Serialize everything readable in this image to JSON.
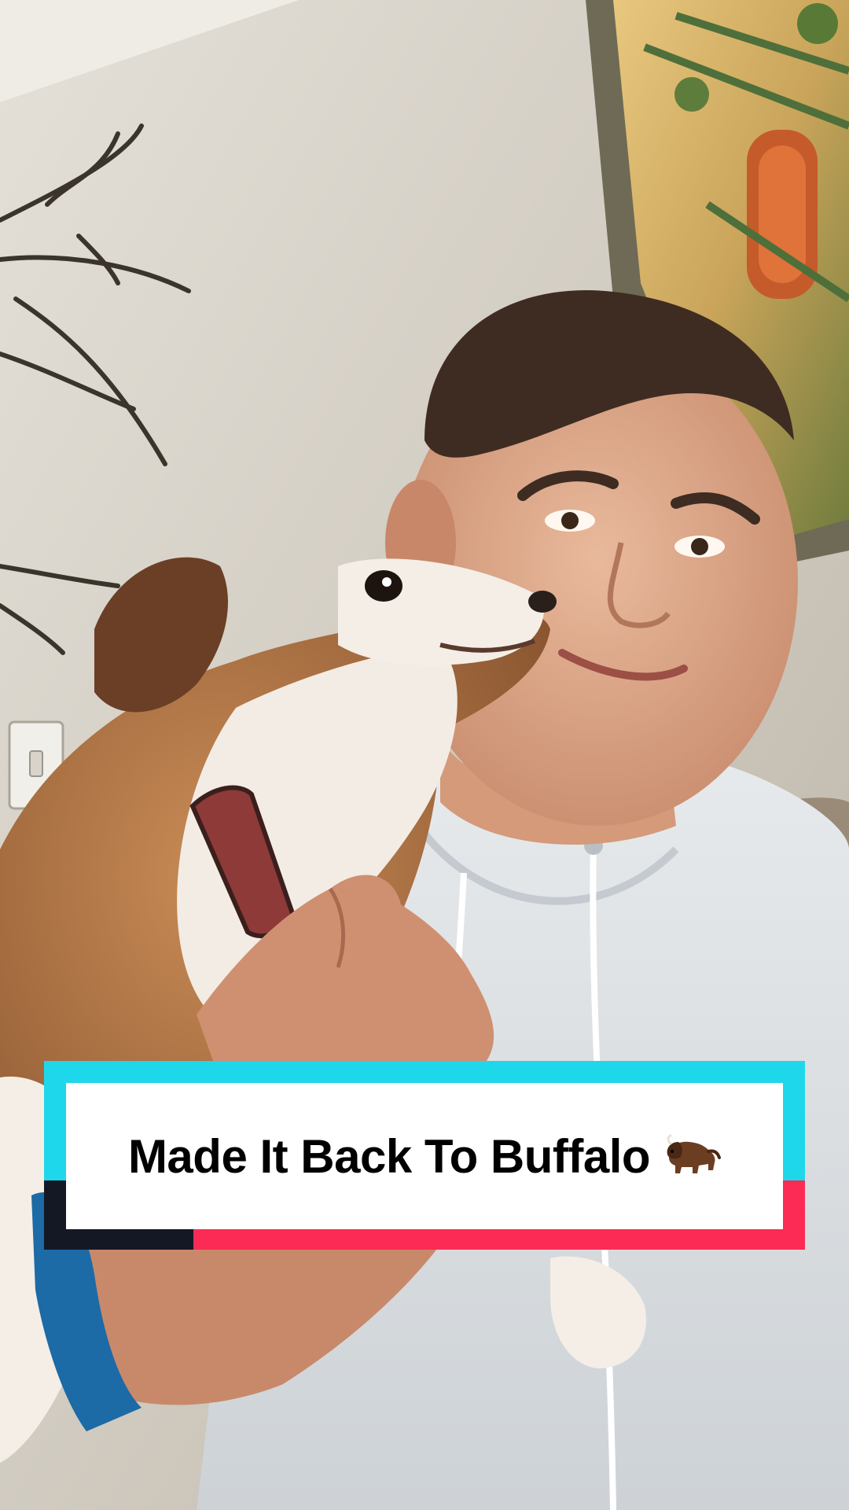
{
  "caption": {
    "text": "Made It Back To Buffalo",
    "emoji_icon": "bison-icon"
  },
  "colors": {
    "banner_cyan": "#1fd7ea",
    "banner_red": "#fc2b55",
    "banner_dark": "#141824",
    "caption_box": "#ffffff",
    "caption_text": "#000000"
  }
}
